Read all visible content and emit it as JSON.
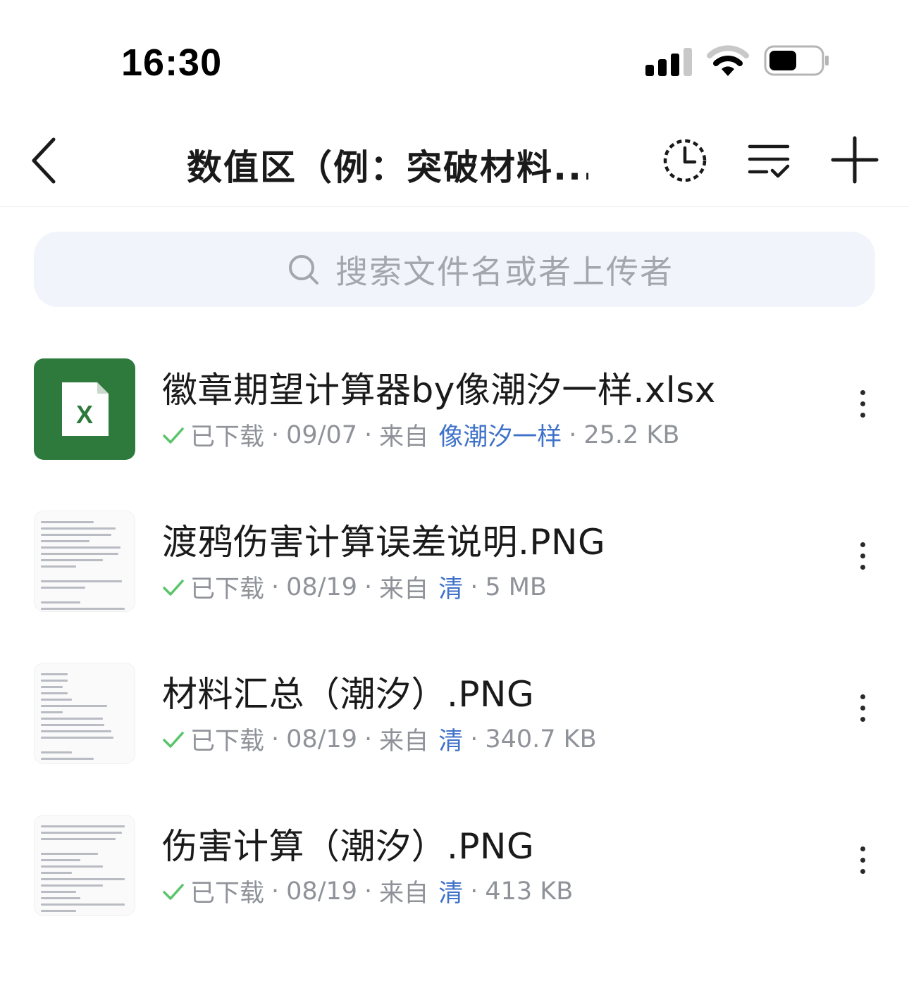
{
  "status_bar": {
    "time": "16:30"
  },
  "nav": {
    "title": "数值区（例：突破材料..."
  },
  "search": {
    "placeholder": "搜索文件名或者上传者"
  },
  "colors": {
    "excel_green": "#2e7a3d",
    "uploader_blue": "#3f72c9",
    "check_green": "#5ac46a",
    "meta_gray": "#8f9298",
    "search_bg": "#f1f4fb"
  },
  "files": [
    {
      "name": "徽章期望计算器by像潮汐一样.xlsx",
      "status": "已下载",
      "date": "09/07",
      "from_label": "来自",
      "uploader": "像潮汐一样",
      "size": "25.2 KB",
      "icon": "excel-file-icon"
    },
    {
      "name": "渡鸦伤害计算误差说明.PNG",
      "status": "已下载",
      "date": "08/19",
      "from_label": "来自",
      "uploader": "清",
      "size": "5 MB",
      "icon": "image-thumbnail"
    },
    {
      "name": "材料汇总（潮汐）.PNG",
      "status": "已下载",
      "date": "08/19",
      "from_label": "来自",
      "uploader": "清",
      "size": "340.7 KB",
      "icon": "image-thumbnail"
    },
    {
      "name": "伤害计算（潮汐）.PNG",
      "status": "已下载",
      "date": "08/19",
      "from_label": "来自",
      "uploader": "清",
      "size": "413 KB",
      "icon": "image-thumbnail"
    }
  ]
}
